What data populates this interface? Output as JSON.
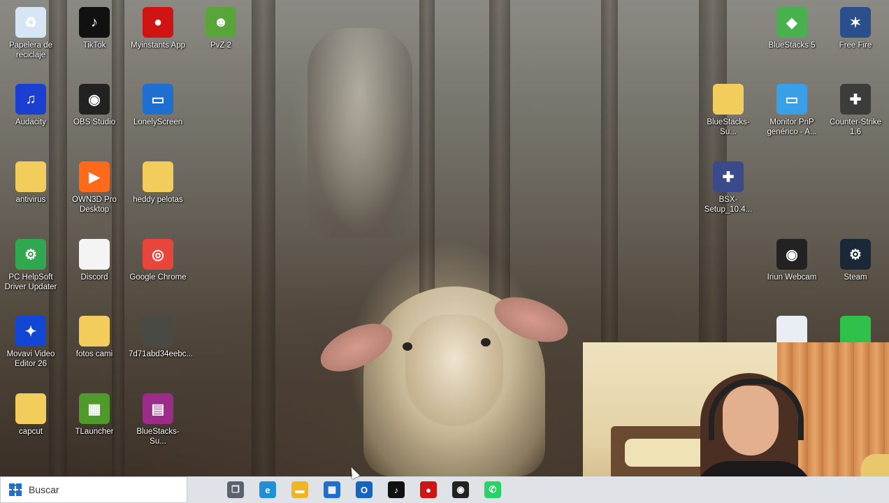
{
  "desktop": {
    "icons_left": [
      {
        "label": "Papelera de reciclaje",
        "icon": "recycle-bin-icon",
        "color": "#d7e6f5",
        "glyph": "♻",
        "shortcut": false
      },
      {
        "label": "TikTok",
        "icon": "tiktok-icon",
        "color": "#111111",
        "glyph": "♪",
        "shortcut": true
      },
      {
        "label": "Myinstants App",
        "icon": "myinstants-icon",
        "color": "#d01414",
        "glyph": "●",
        "shortcut": true
      },
      {
        "label": "PvZ 2",
        "icon": "pvz2-icon",
        "color": "#5aa53a",
        "glyph": "☻",
        "shortcut": true
      },
      {
        "label": "Audacity",
        "icon": "audacity-icon",
        "color": "#1b3fd1",
        "glyph": "♫",
        "shortcut": true
      },
      {
        "label": "OBS Studio",
        "icon": "obs-icon",
        "color": "#222222",
        "glyph": "◉",
        "shortcut": true
      },
      {
        "label": "LonelyScreen",
        "icon": "lonelyscreen-icon",
        "color": "#1f6fd0",
        "glyph": "▭",
        "shortcut": true
      },
      {
        "label": "antivirus",
        "icon": "folder-icon",
        "color": "#f2cd5c",
        "glyph": "",
        "shortcut": false
      },
      {
        "label": "OWN3D Pro Desktop",
        "icon": "own3d-icon",
        "color": "#ff6a1a",
        "glyph": "▶",
        "shortcut": true
      },
      {
        "label": "heddy pelotas",
        "icon": "folder-icon",
        "color": "#f2cd5c",
        "glyph": "",
        "shortcut": true
      },
      {
        "label": "PC HelpSoft Driver Updater",
        "icon": "driver-updater-icon",
        "color": "#2fa84f",
        "glyph": "⚙",
        "shortcut": true
      },
      {
        "label": "Discord",
        "icon": "file-icon",
        "color": "#f4f4f4",
        "glyph": "",
        "shortcut": true
      },
      {
        "label": "Google Chrome",
        "icon": "chrome-icon",
        "color": "#e8453c",
        "glyph": "◎",
        "shortcut": true
      },
      {
        "label": "Movavi Video Editor 26",
        "icon": "movavi-icon",
        "color": "#1247d6",
        "glyph": "✦",
        "shortcut": true
      },
      {
        "label": "fotos cami",
        "icon": "folder-icon",
        "color": "#f2cd5c",
        "glyph": "",
        "shortcut": false
      },
      {
        "label": "7d71abd34eebc...",
        "icon": "image-file-icon",
        "color": "#4a4a44",
        "glyph": "",
        "shortcut": false
      },
      {
        "label": "capcut",
        "icon": "folder-icon",
        "color": "#f2cd5c",
        "glyph": "",
        "shortcut": true
      },
      {
        "label": "TLauncher",
        "icon": "tlauncher-icon",
        "color": "#4f9a2a",
        "glyph": "▦",
        "shortcut": true
      },
      {
        "label": "BlueStacks-Su...",
        "icon": "winrar-icon",
        "color": "#9b2c8a",
        "glyph": "▤",
        "shortcut": false
      }
    ],
    "icons_right": [
      {
        "label": "BlueStacks 5",
        "icon": "bluestacks-icon",
        "color": "#48b04c",
        "glyph": "◆",
        "shortcut": true
      },
      {
        "label": "Free Fire",
        "icon": "free-fire-icon",
        "color": "#2a4f8c",
        "glyph": "✶",
        "shortcut": true
      },
      {
        "label": "BlueStacks-Su...",
        "icon": "folder-icon",
        "color": "#f2cd5c",
        "glyph": "",
        "shortcut": false
      },
      {
        "label": "Monitor PnP genérico - A...",
        "icon": "monitor-icon",
        "color": "#39a0e8",
        "glyph": "▭",
        "shortcut": true
      },
      {
        "label": "Counter-Strike 1.6",
        "icon": "counter-strike-icon",
        "color": "#3c3c3c",
        "glyph": "✚",
        "shortcut": true
      },
      {
        "label": "BSX-Setup_10.4...",
        "icon": "bsx-setup-icon",
        "color": "#3a4a8a",
        "glyph": "✚",
        "shortcut": false
      },
      {
        "label": "Iriun Webcam",
        "icon": "iriun-webcam-icon",
        "color": "#222222",
        "glyph": "◉",
        "shortcut": true
      },
      {
        "label": "Steam",
        "icon": "steam-icon",
        "color": "#1b2838",
        "glyph": "⚙",
        "shortcut": true
      },
      {
        "label": "",
        "icon": "document-icon",
        "color": "#e9eef4",
        "glyph": "",
        "shortcut": false
      },
      {
        "label": "",
        "icon": "green-app-icon",
        "color": "#2ec24b",
        "glyph": "",
        "shortcut": false
      }
    ]
  },
  "taskbar": {
    "search_placeholder": "Buscar",
    "apps": [
      {
        "name": "task-view",
        "icon": "task-view-icon",
        "color": "#5a6270",
        "glyph": "❐"
      },
      {
        "name": "edge",
        "icon": "edge-icon",
        "color": "#1f8fd6",
        "glyph": "e"
      },
      {
        "name": "file-explorer",
        "icon": "folder-icon",
        "color": "#f0b429",
        "glyph": "▬"
      },
      {
        "name": "microsoft-store",
        "icon": "store-icon",
        "color": "#1f6fd0",
        "glyph": "▦"
      },
      {
        "name": "outlook",
        "icon": "outlook-icon",
        "color": "#1464c0",
        "glyph": "O"
      },
      {
        "name": "tiktok",
        "icon": "tiktok-icon",
        "color": "#111111",
        "glyph": "♪"
      },
      {
        "name": "myinstants",
        "icon": "myinstants-icon",
        "color": "#d01414",
        "glyph": "●"
      },
      {
        "name": "obs-studio",
        "icon": "obs-icon",
        "color": "#222222",
        "glyph": "◉"
      },
      {
        "name": "whatsapp",
        "icon": "whatsapp-icon",
        "color": "#25d366",
        "glyph": "✆"
      }
    ]
  }
}
